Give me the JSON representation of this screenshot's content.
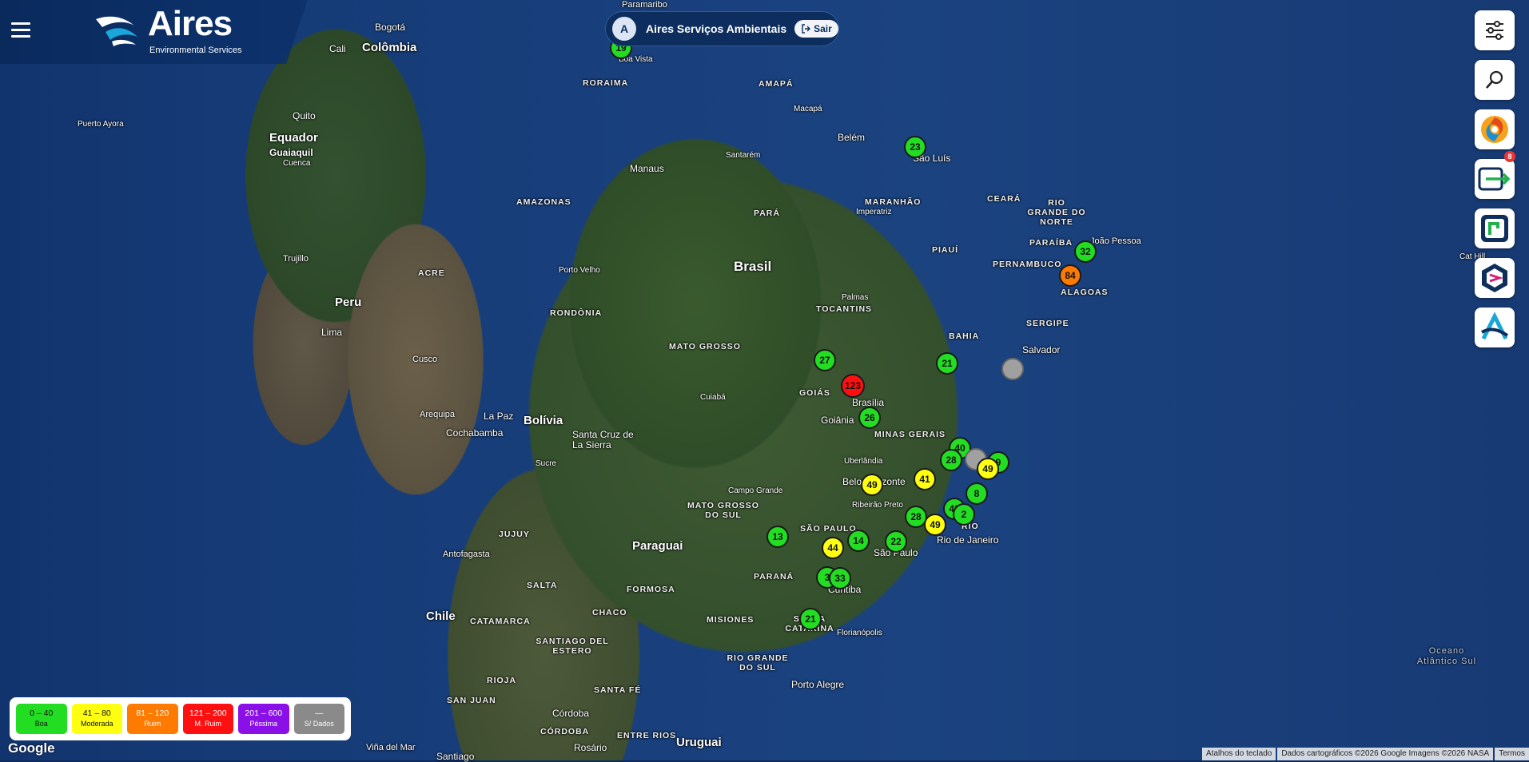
{
  "header": {
    "brand": "Aires",
    "brand_sub": "Environmental Services"
  },
  "user": {
    "avatar_initial": "A",
    "name": "Aires Serviços Ambientais",
    "logout_label": "Sair"
  },
  "toolbar": {
    "notification_count": "8",
    "icons": [
      "sliders-icon",
      "search-icon",
      "swirl-app-icon",
      "export-icon",
      "r-app-icon",
      "hex-app-icon",
      "a-app-icon"
    ]
  },
  "legend": [
    {
      "range": "0 – 40",
      "label": "Boa",
      "color": "#22dd22",
      "text": "#111"
    },
    {
      "range": "41 – 80",
      "label": "Moderada",
      "color": "#ffff11",
      "text": "#111"
    },
    {
      "range": "81 – 120",
      "label": "Ruim",
      "color": "#ff7a00",
      "text": "#fff"
    },
    {
      "range": "121 – 200",
      "label": "M. Ruim",
      "color": "#ff1010",
      "text": "#fff"
    },
    {
      "range": "201 – 600",
      "label": "Péssima",
      "color": "#8b10e8",
      "text": "#fff"
    },
    {
      "range": "—",
      "label": "S/ Dados",
      "color": "#8a8a8a",
      "text": "#fff"
    }
  ],
  "map": {
    "countries": [
      "Brasil",
      "Colômbia",
      "Equador",
      "Peru",
      "Bolívia",
      "Paraguai",
      "Chile",
      "Uruguai"
    ],
    "cities": [
      "Bogotá",
      "Cali",
      "Quito",
      "Guaiaquil",
      "Cuenca",
      "Puerto Ayora",
      "Trujillo",
      "Lima",
      "Cusco",
      "Arequipa",
      "La Paz",
      "Cochabamba",
      "Santa Cruz de La Sierra",
      "Sucre",
      "Antofagasta",
      "Córdoba",
      "Rosário",
      "Santiago",
      "Viña del Mar",
      "Paramaribo",
      "Boa Vista",
      "Macapá",
      "Belém",
      "São Luís",
      "Santarém",
      "Manaus",
      "Imperatriz",
      "Porto Velho",
      "Palmas",
      "Cuiabá",
      "Brasília",
      "Goiânia",
      "Uberlândia",
      "Belo Horizonte",
      "Ribeirão Preto",
      "Campo Grande",
      "São Paulo",
      "Rio de Janeiro",
      "Curitiba",
      "Florianópolis",
      "Porto Alegre",
      "Salvador",
      "João Pessoa",
      "Cat Hill"
    ],
    "states": [
      "RORAIMA",
      "AMAPÁ",
      "AMAZONAS",
      "PARÁ",
      "MARANHÃO",
      "CEARÁ",
      "RIO GRANDE DO NORTE",
      "PARAÍBA",
      "PIAUÍ",
      "PERNAMBUCO",
      "ALAGOAS",
      "SERGIPE",
      "ACRE",
      "RONDÔNIA",
      "TOCANTINS",
      "BAHIA",
      "MATO GROSSO",
      "GOIÁS",
      "MINAS GERAIS",
      "MATO GROSSO DO SUL",
      "SÃO PAULO",
      "PARANÁ",
      "SANTA CATARINA",
      "RIO GRANDE DO SUL",
      "JUJUY",
      "SALTA",
      "CATAMARCA",
      "FORMOSA",
      "CHACO",
      "MISIONES",
      "SANTIAGO DEL ESTERO",
      "RIOJA",
      "SAN JUAN",
      "SANTA FÉ",
      "CÓRDOBA",
      "ENTRE RIOS",
      "RIO"
    ],
    "ocean": "Oceano Atlântico Sul"
  },
  "markers": [
    {
      "value": "19",
      "level": "good"
    },
    {
      "value": "23",
      "level": "good"
    },
    {
      "value": "32",
      "level": "good"
    },
    {
      "value": "84",
      "level": "bad"
    },
    {
      "value": "27",
      "level": "good"
    },
    {
      "value": "21",
      "level": "good"
    },
    {
      "value": "",
      "level": "nodata"
    },
    {
      "value": "123",
      "level": "verybad"
    },
    {
      "value": "26",
      "level": "good"
    },
    {
      "value": "40",
      "level": "good"
    },
    {
      "value": "28",
      "level": "good"
    },
    {
      "value": "",
      "level": "nodata"
    },
    {
      "value": "9",
      "level": "good"
    },
    {
      "value": "49",
      "level": "moderate"
    },
    {
      "value": "41",
      "level": "moderate"
    },
    {
      "value": "49",
      "level": "moderate"
    },
    {
      "value": "8",
      "level": "good"
    },
    {
      "value": "40",
      "level": "good"
    },
    {
      "value": "28",
      "level": "good"
    },
    {
      "value": "49",
      "level": "moderate"
    },
    {
      "value": "2",
      "level": "good"
    },
    {
      "value": "13",
      "level": "good"
    },
    {
      "value": "44",
      "level": "moderate"
    },
    {
      "value": "14",
      "level": "good"
    },
    {
      "value": "22",
      "level": "good"
    },
    {
      "value": "3",
      "level": "good"
    },
    {
      "value": "33",
      "level": "good"
    },
    {
      "value": "21",
      "level": "good"
    }
  ],
  "footer": {
    "google": "Google",
    "shortcuts": "Atalhos do teclado",
    "data_credit": "Dados cartográficos ©2026 Google Imagens ©2026 NASA",
    "terms": "Termos"
  }
}
